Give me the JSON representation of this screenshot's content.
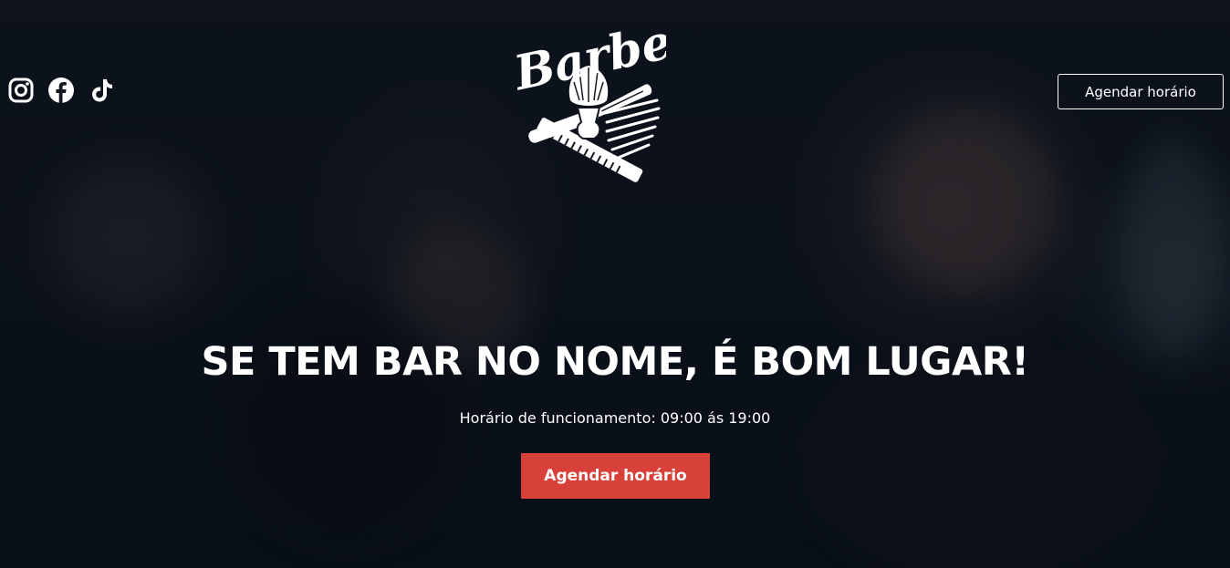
{
  "social": {
    "icons": [
      "instagram-icon",
      "facebook-icon",
      "tiktok-icon"
    ]
  },
  "logo": {
    "text": "Barber"
  },
  "header": {
    "cta_label": "Agendar horário"
  },
  "hero": {
    "headline": "SE TEM BAR NO NOME, É BOM LUGAR!",
    "hours": "Horário de funcionamento: 09:00 ás 19:00",
    "cta_label": "Agendar horário"
  },
  "colors": {
    "accent": "#d8403a",
    "overlay": "#0c1019",
    "text": "#ffffff"
  }
}
